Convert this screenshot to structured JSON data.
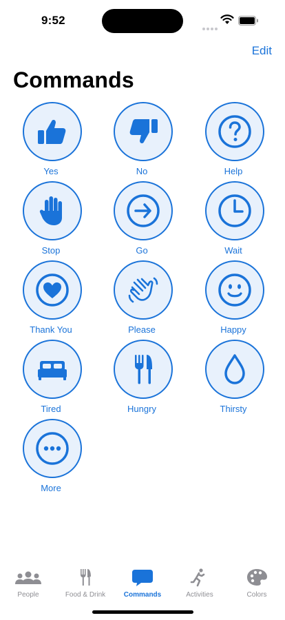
{
  "status": {
    "time": "9:52"
  },
  "header": {
    "edit_label": "Edit",
    "title": "Commands"
  },
  "commands": [
    {
      "label": "Yes",
      "icon": "thumbs-up-icon"
    },
    {
      "label": "No",
      "icon": "thumbs-down-icon"
    },
    {
      "label": "Help",
      "icon": "question-icon"
    },
    {
      "label": "Stop",
      "icon": "hand-stop-icon"
    },
    {
      "label": "Go",
      "icon": "arrow-right-icon"
    },
    {
      "label": "Wait",
      "icon": "clock-icon"
    },
    {
      "label": "Thank You",
      "icon": "heart-icon"
    },
    {
      "label": "Please",
      "icon": "waving-hands-icon"
    },
    {
      "label": "Happy",
      "icon": "smiley-icon"
    },
    {
      "label": "Tired",
      "icon": "bed-icon"
    },
    {
      "label": "Hungry",
      "icon": "fork-knife-icon"
    },
    {
      "label": "Thirsty",
      "icon": "drop-icon"
    },
    {
      "label": "More",
      "icon": "ellipsis-icon"
    }
  ],
  "tabs": [
    {
      "label": "People",
      "icon": "people-icon"
    },
    {
      "label": "Food & Drink",
      "icon": "fork-knife-icon"
    },
    {
      "label": "Commands",
      "icon": "speech-bubble-icon",
      "active": true
    },
    {
      "label": "Activities",
      "icon": "running-icon"
    },
    {
      "label": "Colors",
      "icon": "palette-icon"
    }
  ],
  "colors": {
    "accent": "#1a73d9",
    "circle_fill": "#e8f1fc",
    "inactive": "#8e8e93"
  }
}
